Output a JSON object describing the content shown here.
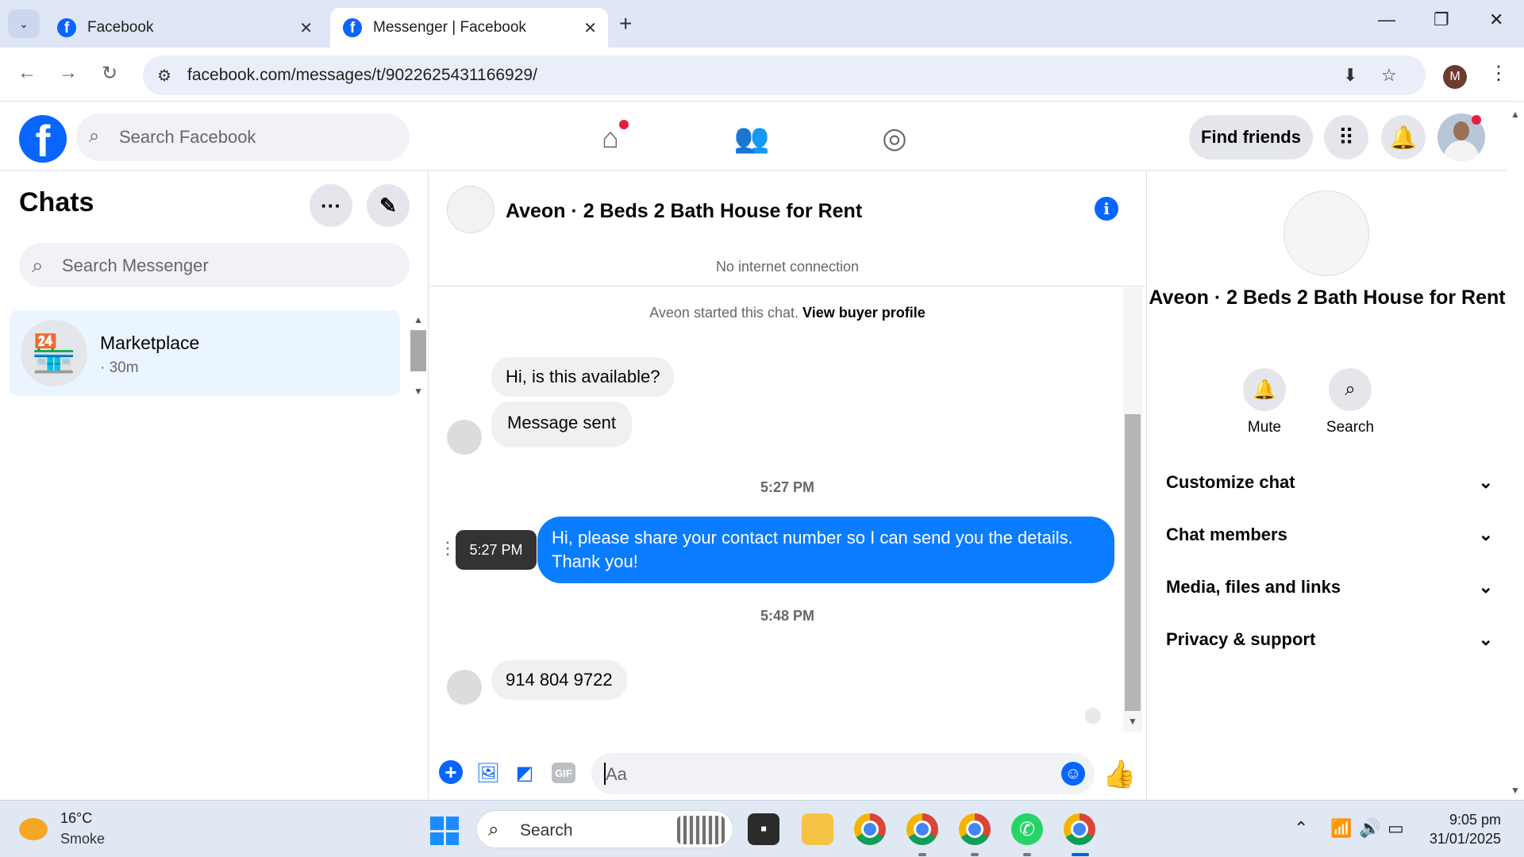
{
  "browser": {
    "tabs": [
      {
        "title": "Facebook",
        "active": false
      },
      {
        "title": "Messenger | Facebook",
        "active": true
      }
    ],
    "url": "facebook.com/messages/t/9022625431166929/",
    "profile_initial": "M"
  },
  "fb_header": {
    "search_placeholder": "Search Facebook",
    "find_friends": "Find friends",
    "accent": "#0866ff"
  },
  "sidebar": {
    "title": "Chats",
    "search_placeholder": "Search Messenger",
    "chats": [
      {
        "name": "Marketplace",
        "time": "· 30m"
      }
    ]
  },
  "conversation": {
    "title": "Aveon · 2 Beds 2 Bath House for Rent",
    "status": "No internet connection",
    "started_prefix": "Aveon started this chat.",
    "started_link": "View buyer profile",
    "messages": [
      {
        "from": "them",
        "text": "Hi, is this available?"
      },
      {
        "from": "them",
        "text": "Message sent"
      },
      {
        "stamp": "5:27 PM"
      },
      {
        "from": "me",
        "text": "Hi, please share your contact number so I can send you the details. Thank you!"
      },
      {
        "stamp": "5:48 PM"
      },
      {
        "from": "them",
        "text": "914 804 9722"
      }
    ],
    "tooltip": "5:27 PM",
    "composer_placeholder": "Aa",
    "gif_label": "GIF"
  },
  "info_panel": {
    "title": "Aveon · 2 Beds 2 Bath House for Rent",
    "actions": [
      {
        "label": "Mute",
        "icon": "bell-icon"
      },
      {
        "label": "Search",
        "icon": "search-icon"
      }
    ],
    "sections": [
      "Customize chat",
      "Chat members",
      "Media, files and links",
      "Privacy & support"
    ]
  },
  "taskbar": {
    "temp": "16°C",
    "weather": "Smoke",
    "search_placeholder": "Search",
    "time": "9:05 pm",
    "date": "31/01/2025"
  }
}
